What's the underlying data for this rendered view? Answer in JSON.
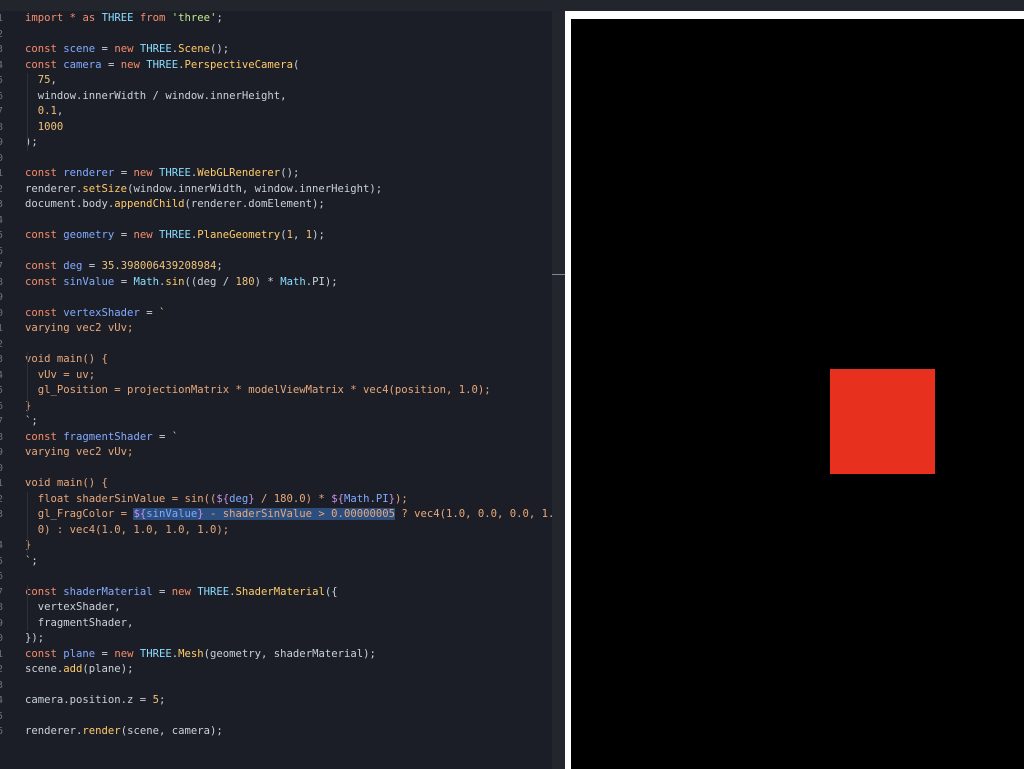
{
  "editor": {
    "lines": [
      {
        "n": "1",
        "segs": [
          [
            "kw",
            "import"
          ],
          [
            "",
            " "
          ],
          [
            "kw",
            "*"
          ],
          [
            "",
            " "
          ],
          [
            "kw",
            "as"
          ],
          [
            "",
            " "
          ],
          [
            "cls",
            "THREE"
          ],
          [
            "",
            " "
          ],
          [
            "kw",
            "from"
          ],
          [
            "",
            " "
          ],
          [
            "str",
            "'three'"
          ],
          [
            "",
            ";"
          ]
        ]
      },
      {
        "n": "2",
        "segs": []
      },
      {
        "n": "3",
        "segs": [
          [
            "kw",
            "const"
          ],
          [
            "",
            " "
          ],
          [
            "var",
            "scene"
          ],
          [
            "",
            " = "
          ],
          [
            "kw",
            "new"
          ],
          [
            "",
            " "
          ],
          [
            "cls",
            "THREE"
          ],
          [
            "",
            "."
          ],
          [
            "fn",
            "Scene"
          ],
          [
            "",
            "();"
          ]
        ]
      },
      {
        "n": "4",
        "segs": [
          [
            "kw",
            "const"
          ],
          [
            "",
            " "
          ],
          [
            "var",
            "camera"
          ],
          [
            "",
            " = "
          ],
          [
            "kw",
            "new"
          ],
          [
            "",
            " "
          ],
          [
            "cls",
            "THREE"
          ],
          [
            "",
            "."
          ],
          [
            "fn",
            "PerspectiveCamera"
          ],
          [
            "",
            "("
          ]
        ]
      },
      {
        "n": "5",
        "segs": [
          [
            "",
            "  "
          ],
          [
            "num",
            "75"
          ],
          [
            "",
            ","
          ]
        ]
      },
      {
        "n": "6",
        "segs": [
          [
            "",
            "  window.innerWidth / window.innerHeight,"
          ]
        ]
      },
      {
        "n": "7",
        "segs": [
          [
            "",
            "  "
          ],
          [
            "num",
            "0.1"
          ],
          [
            "",
            ","
          ]
        ]
      },
      {
        "n": "8",
        "segs": [
          [
            "",
            "  "
          ],
          [
            "num",
            "1000"
          ]
        ]
      },
      {
        "n": "9",
        "segs": [
          [
            "",
            ");"
          ]
        ]
      },
      {
        "n": "0",
        "segs": []
      },
      {
        "n": "1",
        "segs": [
          [
            "kw",
            "const"
          ],
          [
            "",
            " "
          ],
          [
            "var",
            "renderer"
          ],
          [
            "",
            " = "
          ],
          [
            "kw",
            "new"
          ],
          [
            "",
            " "
          ],
          [
            "cls",
            "THREE"
          ],
          [
            "",
            "."
          ],
          [
            "fn",
            "WebGLRenderer"
          ],
          [
            "",
            "();"
          ]
        ]
      },
      {
        "n": "2",
        "segs": [
          [
            "",
            "renderer."
          ],
          [
            "fn",
            "setSize"
          ],
          [
            "",
            "(window.innerWidth, window.innerHeight);"
          ]
        ]
      },
      {
        "n": "3",
        "segs": [
          [
            "",
            "document.body."
          ],
          [
            "fn",
            "appendChild"
          ],
          [
            "",
            "(renderer.domElement);"
          ]
        ]
      },
      {
        "n": "4",
        "segs": []
      },
      {
        "n": "5",
        "segs": [
          [
            "kw",
            "const"
          ],
          [
            "",
            " "
          ],
          [
            "var",
            "geometry"
          ],
          [
            "",
            " = "
          ],
          [
            "kw",
            "new"
          ],
          [
            "",
            " "
          ],
          [
            "cls",
            "THREE"
          ],
          [
            "",
            "."
          ],
          [
            "fn",
            "PlaneGeometry"
          ],
          [
            "",
            "("
          ],
          [
            "num",
            "1"
          ],
          [
            "",
            ", "
          ],
          [
            "num",
            "1"
          ],
          [
            "",
            ");"
          ]
        ]
      },
      {
        "n": "6",
        "segs": []
      },
      {
        "n": "7",
        "segs": [
          [
            "kw",
            "const"
          ],
          [
            "",
            " "
          ],
          [
            "var",
            "deg"
          ],
          [
            "",
            " = "
          ],
          [
            "num",
            "35.398006439208984"
          ],
          [
            "",
            ";"
          ]
        ]
      },
      {
        "n": "8",
        "segs": [
          [
            "kw",
            "const"
          ],
          [
            "",
            " "
          ],
          [
            "var",
            "sinValue"
          ],
          [
            "",
            " = "
          ],
          [
            "cls",
            "Math"
          ],
          [
            "",
            "."
          ],
          [
            "fn",
            "sin"
          ],
          [
            "",
            "((deg / "
          ],
          [
            "num",
            "180"
          ],
          [
            "",
            ") * "
          ],
          [
            "cls",
            "Math"
          ],
          [
            "",
            ".PI);"
          ]
        ]
      },
      {
        "n": "9",
        "segs": []
      },
      {
        "n": "0",
        "segs": [
          [
            "kw",
            "const"
          ],
          [
            "",
            " "
          ],
          [
            "var",
            "vertexShader"
          ],
          [
            "",
            " = "
          ],
          [
            "str",
            "`"
          ]
        ]
      },
      {
        "n": "1",
        "segs": [
          [
            "sh",
            "varying vec2 vUv;"
          ]
        ]
      },
      {
        "n": "2",
        "segs": []
      },
      {
        "n": "3",
        "segs": [
          [
            "sh",
            "void main() {"
          ]
        ]
      },
      {
        "n": "4",
        "segs": [
          [
            "sh",
            "  vUv = uv;"
          ]
        ]
      },
      {
        "n": "5",
        "segs": [
          [
            "sh",
            "  gl_Position = projectionMatrix * modelViewMatrix * vec4(position, 1.0);"
          ]
        ]
      },
      {
        "n": "6",
        "segs": [
          [
            "sh",
            "}"
          ]
        ]
      },
      {
        "n": "7",
        "segs": [
          [
            "str",
            "`"
          ],
          [
            "",
            ";"
          ]
        ]
      },
      {
        "n": "8",
        "segs": [
          [
            "kw",
            "const"
          ],
          [
            "",
            " "
          ],
          [
            "var",
            "fragmentShader"
          ],
          [
            "",
            " = "
          ],
          [
            "str",
            "`"
          ]
        ]
      },
      {
        "n": "9",
        "segs": [
          [
            "sh",
            "varying vec2 vUv;"
          ]
        ]
      },
      {
        "n": "0",
        "segs": []
      },
      {
        "n": "1",
        "segs": [
          [
            "sh",
            "void main() {"
          ]
        ]
      },
      {
        "n": "2",
        "segs": [
          [
            "sh",
            "  float shaderSinValue = sin(("
          ],
          [
            "kw2",
            "${"
          ],
          [
            "var",
            "deg"
          ],
          [
            "kw2",
            "}"
          ],
          [
            "sh",
            " / 180.0) * "
          ],
          [
            "kw2",
            "${"
          ],
          [
            "var",
            "Math.PI"
          ],
          [
            "kw2",
            "}"
          ],
          [
            "sh",
            ");"
          ]
        ]
      },
      {
        "n": "3",
        "segs": [
          [
            "sh",
            "  gl_FragColor = "
          ],
          [
            "kw2 sel",
            "${"
          ],
          [
            "var sel",
            "sinValue"
          ],
          [
            "kw2 sel",
            "}"
          ],
          [
            "sh sel",
            " - shaderSinValue > 0.00000005"
          ],
          [
            "sh",
            " ? vec4(1.0, 0.0, 0.0, 1."
          ]
        ]
      },
      {
        "n": "",
        "segs": [
          [
            "sh",
            "  0) : vec4(1.0, 1.0, 1.0, 1.0);"
          ]
        ]
      },
      {
        "n": "4",
        "segs": [
          [
            "sh",
            "}"
          ]
        ]
      },
      {
        "n": "5",
        "segs": [
          [
            "str",
            "`"
          ],
          [
            "",
            ";"
          ]
        ]
      },
      {
        "n": "6",
        "segs": []
      },
      {
        "n": "7",
        "segs": [
          [
            "kw",
            "const"
          ],
          [
            "",
            " "
          ],
          [
            "var",
            "shaderMaterial"
          ],
          [
            "",
            " = "
          ],
          [
            "kw",
            "new"
          ],
          [
            "",
            " "
          ],
          [
            "cls",
            "THREE"
          ],
          [
            "",
            "."
          ],
          [
            "fn",
            "ShaderMaterial"
          ],
          [
            "",
            "({"
          ]
        ]
      },
      {
        "n": "8",
        "segs": [
          [
            "",
            "  vertexShader,"
          ]
        ]
      },
      {
        "n": "9",
        "segs": [
          [
            "",
            "  fragmentShader,"
          ]
        ]
      },
      {
        "n": "0",
        "segs": [
          [
            "",
            "});"
          ]
        ]
      },
      {
        "n": "1",
        "segs": [
          [
            "kw",
            "const"
          ],
          [
            "",
            " "
          ],
          [
            "var",
            "plane"
          ],
          [
            "",
            " = "
          ],
          [
            "kw",
            "new"
          ],
          [
            "",
            " "
          ],
          [
            "cls",
            "THREE"
          ],
          [
            "",
            "."
          ],
          [
            "fn",
            "Mesh"
          ],
          [
            "",
            "(geometry, shaderMaterial);"
          ]
        ]
      },
      {
        "n": "2",
        "segs": [
          [
            "",
            "scene."
          ],
          [
            "fn",
            "add"
          ],
          [
            "",
            "(plane);"
          ]
        ]
      },
      {
        "n": "3",
        "segs": []
      },
      {
        "n": "4",
        "segs": [
          [
            "",
            "camera.position.z = "
          ],
          [
            "num",
            "5"
          ],
          [
            "",
            ";"
          ]
        ]
      },
      {
        "n": "5",
        "segs": []
      },
      {
        "n": "6",
        "segs": [
          [
            "",
            "renderer."
          ],
          [
            "fn",
            "render"
          ],
          [
            "",
            "(scene, camera);"
          ]
        ]
      }
    ]
  },
  "preview": {
    "background": "#000000",
    "plane_color": "#e8301f"
  }
}
